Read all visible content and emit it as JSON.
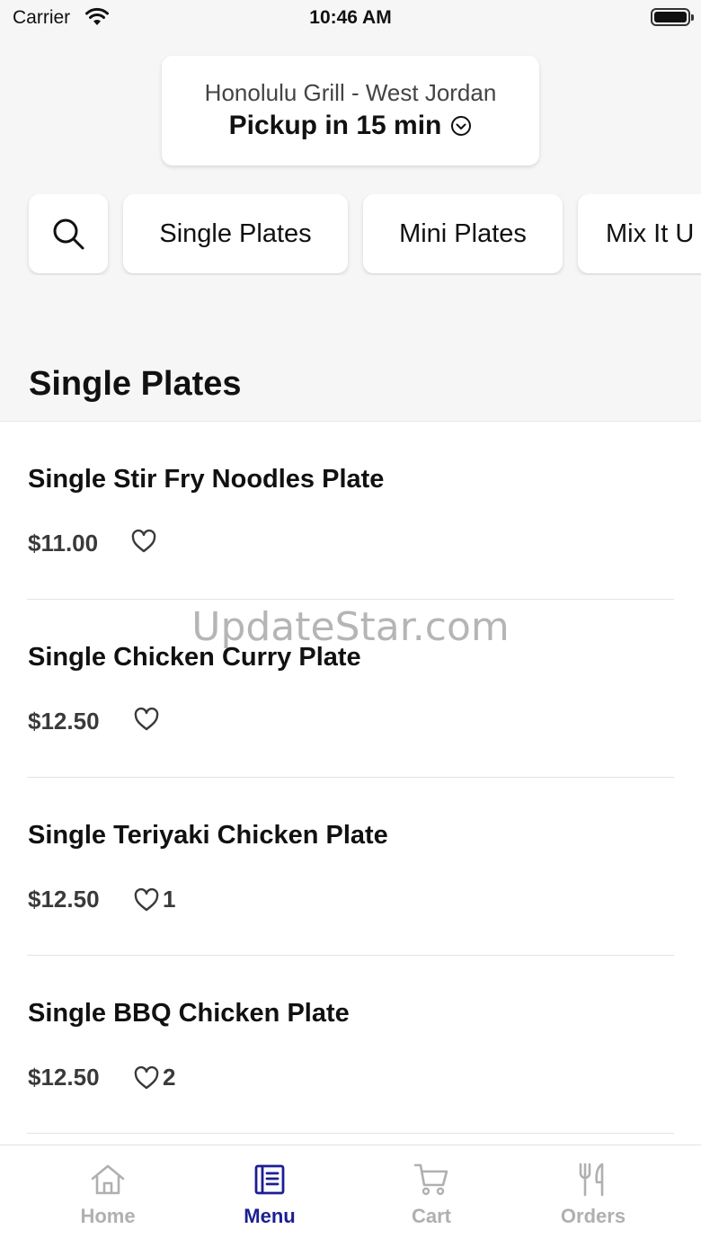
{
  "status_bar": {
    "carrier": "Carrier",
    "time": "10:46 AM"
  },
  "location": {
    "store": "Honolulu Grill - West Jordan",
    "pickup": "Pickup in 15 min"
  },
  "categories": [
    "Single Plates",
    "Mini Plates",
    "Mix It U"
  ],
  "section_title": "Single Plates",
  "items": [
    {
      "name": "Single Stir Fry Noodles Plate",
      "price": "$11.00",
      "likes": ""
    },
    {
      "name": "Single Chicken Curry Plate",
      "price": "$12.50",
      "likes": ""
    },
    {
      "name": "Single Teriyaki Chicken Plate",
      "price": "$12.50",
      "likes": "1"
    },
    {
      "name": "Single BBQ Chicken Plate",
      "price": "$12.50",
      "likes": "2"
    }
  ],
  "watermark": "UpdateStar.com",
  "tabs": [
    {
      "label": "Home",
      "icon": "home-icon",
      "active": false
    },
    {
      "label": "Menu",
      "icon": "menu-icon",
      "active": true
    },
    {
      "label": "Cart",
      "icon": "cart-icon",
      "active": false
    },
    {
      "label": "Orders",
      "icon": "fork-knife-icon",
      "active": false
    }
  ],
  "colors": {
    "accent": "#1b1f93",
    "inactive_tab": "#b0b0b0"
  }
}
